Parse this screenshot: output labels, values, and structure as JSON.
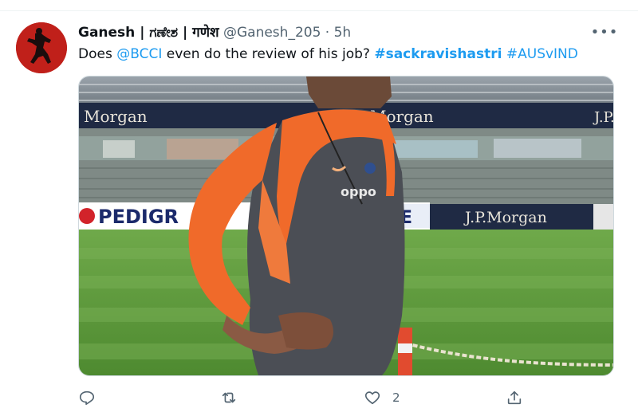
{
  "tweet": {
    "display_name": "Ganesh | ಗಣೇಶ | गणेश",
    "handle": "@Ganesh_205",
    "separator": "·",
    "timestamp": "5h",
    "more_label": "•••",
    "text_prefix": "Does ",
    "mention": "@BCCI",
    "text_middle": " even do the review of his job? ",
    "hashtag_1": "#sackravishastri",
    "hashtag_2": "#AUSvIND"
  },
  "media": {
    "banners": {
      "morgan_left": "Morgan",
      "morgan_center": "Morgan",
      "jp_edge": "J.P.",
      "pedigree": "PEDIGR",
      "fee": "EE",
      "jp_morgan": "J.P.Morgan"
    },
    "jersey_brand": "oppo"
  },
  "actions": {
    "reply_count": "",
    "retweet_count": "",
    "like_count": "2",
    "share_count": ""
  },
  "colors": {
    "link": "#1d9bf0",
    "secondary_text": "#536471",
    "jersey_orange": "#f06a2a",
    "jersey_grey": "#4b4e55",
    "banner_navy": "#1f2a44",
    "grass": "#5e9a3c"
  }
}
